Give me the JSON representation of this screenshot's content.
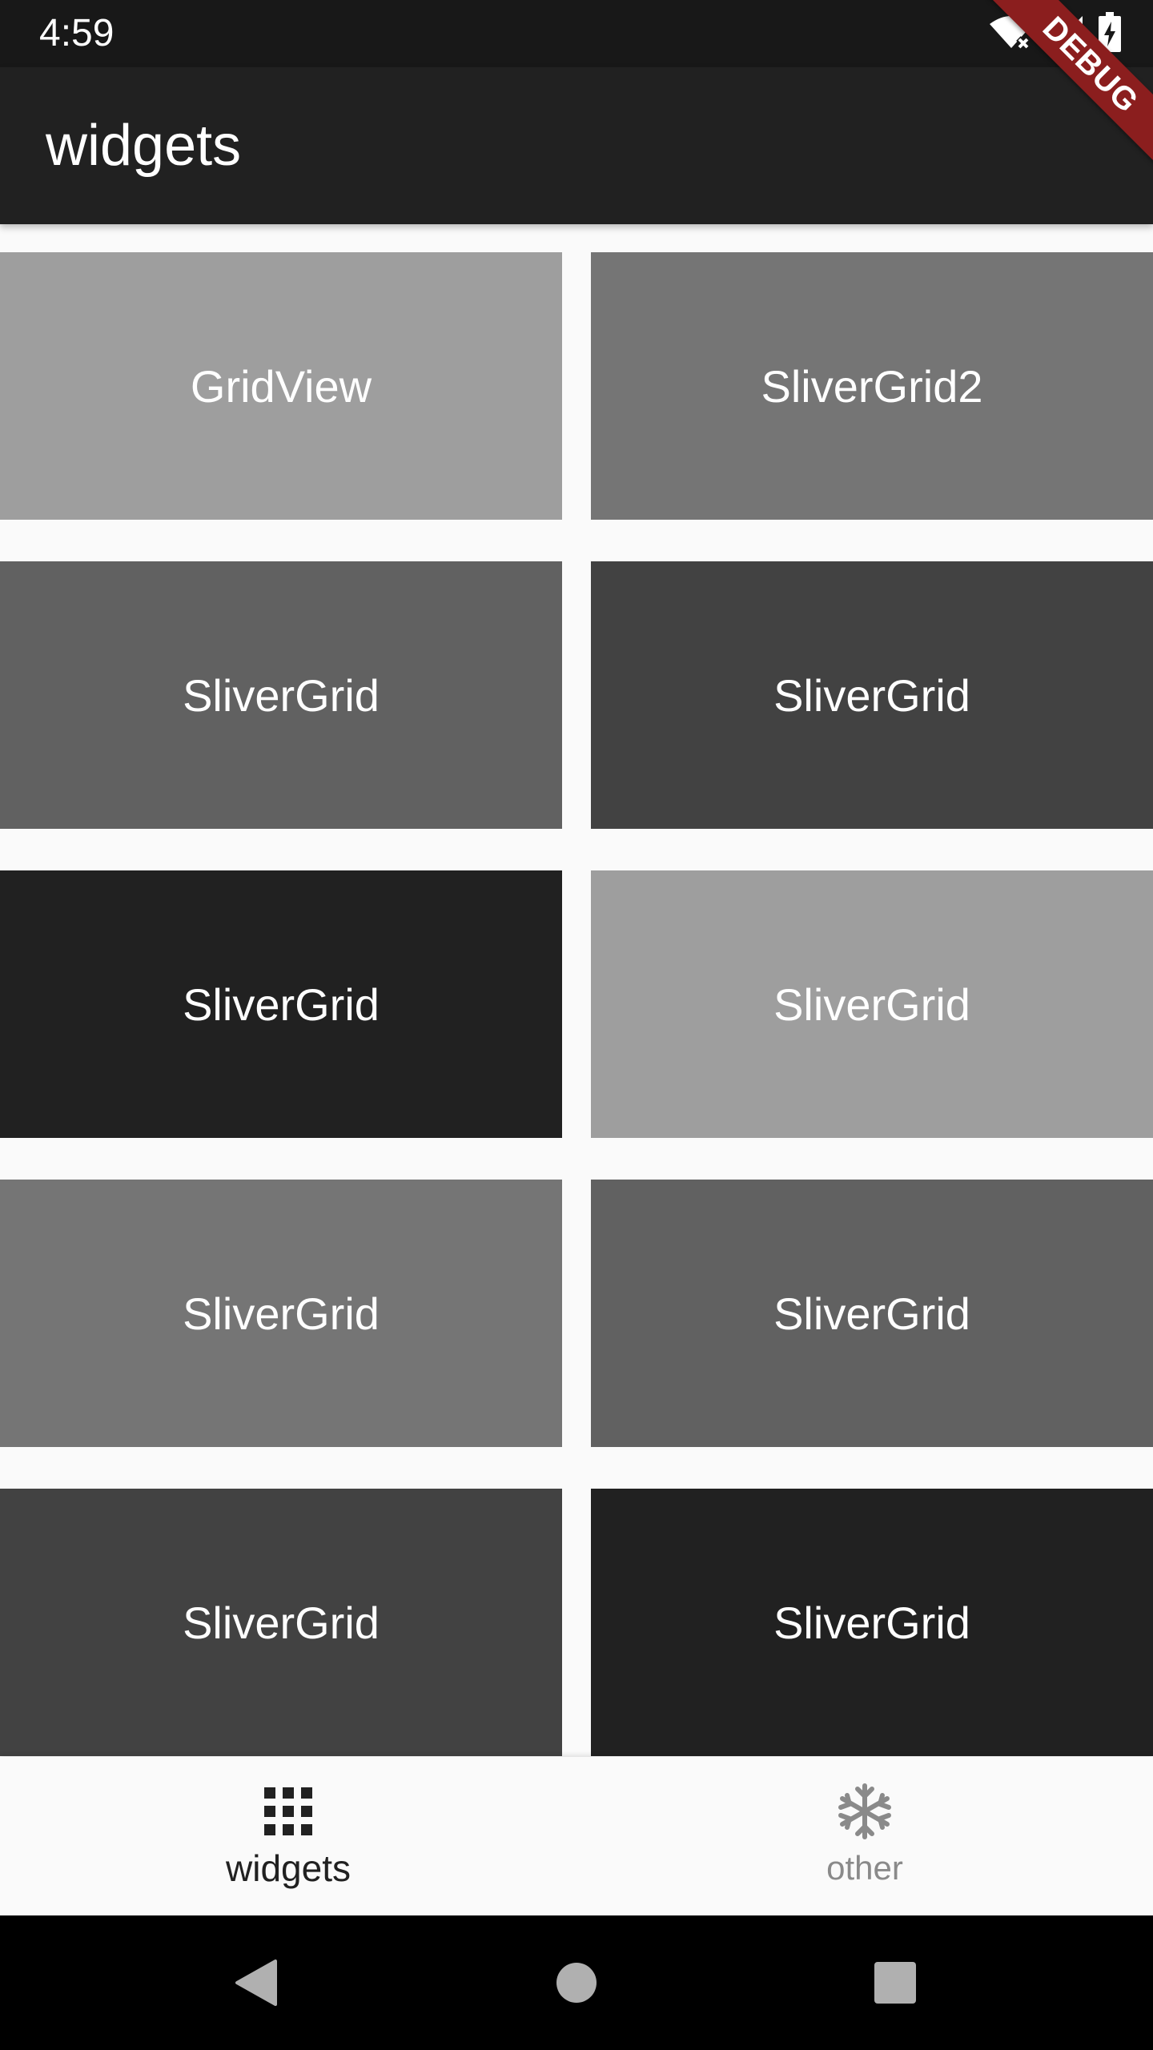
{
  "status_bar": {
    "time": "4:59",
    "icons": [
      "wifi-off-icon",
      "signal-icon",
      "battery-charging-icon"
    ]
  },
  "debug_banner": {
    "label": "DEBUG",
    "color": "#8b1e1e"
  },
  "app_bar": {
    "title": "widgets",
    "background": "#212121"
  },
  "grid": {
    "items": [
      {
        "label": "GridView",
        "color": "#9e9e9e"
      },
      {
        "label": "SliverGrid2",
        "color": "#757575"
      },
      {
        "label": "SliverGrid",
        "color": "#616161"
      },
      {
        "label": "SliverGrid",
        "color": "#424242"
      },
      {
        "label": "SliverGrid",
        "color": "#212121"
      },
      {
        "label": "SliverGrid",
        "color": "#9e9e9e"
      },
      {
        "label": "SliverGrid",
        "color": "#757575"
      },
      {
        "label": "SliverGrid",
        "color": "#616161"
      },
      {
        "label": "SliverGrid",
        "color": "#424242"
      },
      {
        "label": "SliverGrid",
        "color": "#212121"
      }
    ]
  },
  "bottom_nav": {
    "items": [
      {
        "label": "widgets",
        "icon": "apps-grid-icon",
        "active": true,
        "color": "#212121"
      },
      {
        "label": "other",
        "icon": "snowflake-icon",
        "active": false,
        "color": "#8a8a8a"
      }
    ]
  },
  "system_nav": {
    "buttons": [
      "back-icon",
      "home-icon",
      "recents-icon"
    ],
    "color": "#b0b0b0"
  }
}
